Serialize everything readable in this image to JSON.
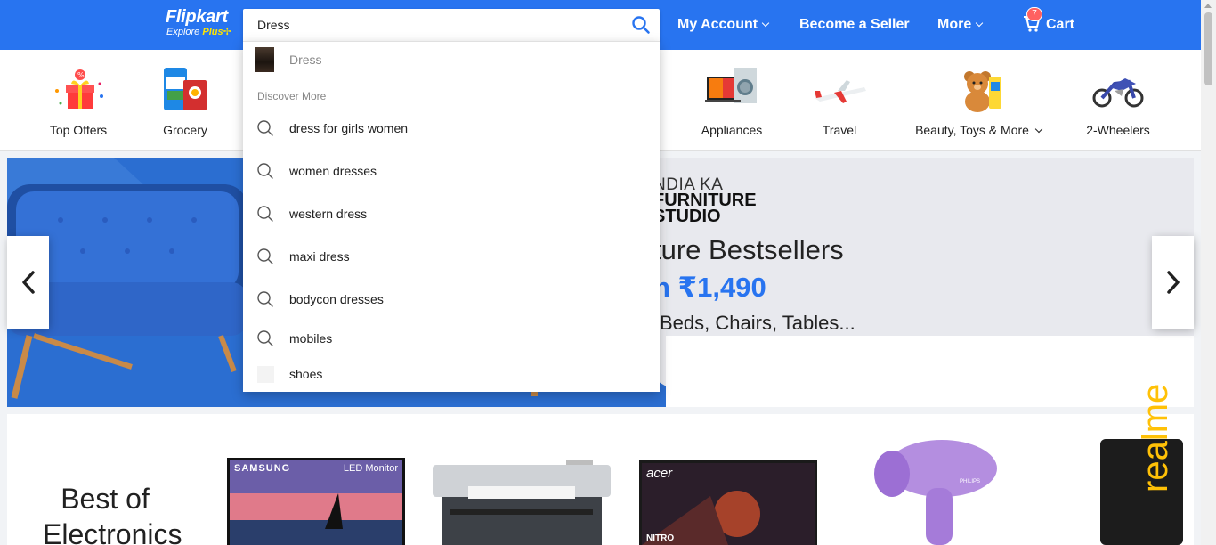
{
  "header": {
    "logo_brand": "Flipkart",
    "logo_sub_explore": "Explore",
    "logo_sub_plus": "Plus",
    "search_value": "Dress",
    "search_icon": "search-icon",
    "nav": {
      "account": "My Account",
      "seller": "Become a Seller",
      "more": "More",
      "cart": "Cart",
      "cart_count": "7"
    },
    "colors": {
      "header_bg": "#2874f0",
      "badge": "#ff6161",
      "plus": "#ffe500"
    }
  },
  "categories": [
    {
      "label": "Top Offers",
      "icon": "gift-offers-icon"
    },
    {
      "label": "Grocery",
      "icon": "grocery-icon"
    },
    {
      "label": "Appliances",
      "icon": "appliances-icon"
    },
    {
      "label": "Travel",
      "icon": "airplane-icon"
    },
    {
      "label": "Beauty, Toys & More",
      "icon": "teddy-bear-icon"
    },
    {
      "label": "2-Wheelers",
      "icon": "motorcycle-icon"
    }
  ],
  "banner": {
    "line1": "NDIA KA",
    "line2a": "FURNITURE",
    "line2b": "STUDIO",
    "line3": "ture Bestsellers",
    "line4": "n ₹1,490",
    "line5": "Beds, Chairs, Tables..."
  },
  "electronics": {
    "title": "Best of Electronics",
    "products": [
      {
        "name": "samsung-monitor",
        "brand": "SAMSUNG",
        "caption": "LED Monitor"
      },
      {
        "name": "printer"
      },
      {
        "name": "acer-monitor",
        "brand": "acer",
        "caption": "NITRO"
      },
      {
        "name": "hair-dryer",
        "brand": "PHILIPS"
      },
      {
        "name": "power-bank",
        "caption": "realme"
      }
    ]
  },
  "dropdown": {
    "first_suggestion": "Dress",
    "discover_label": "Discover More",
    "items": [
      "dress for girls women",
      "women dresses",
      "western dress",
      "maxi dress",
      "bodycon dresses",
      "mobiles",
      "shoes"
    ]
  }
}
